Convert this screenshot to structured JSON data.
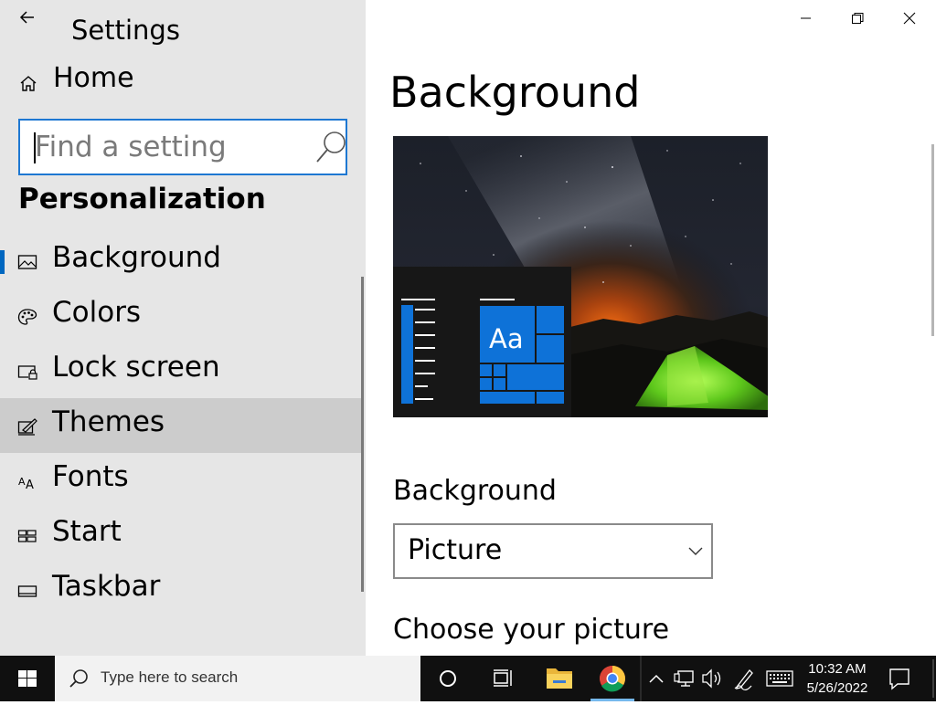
{
  "window": {
    "app_title": "Settings",
    "controls": {
      "minimize": "minimize",
      "restore": "restore",
      "close": "close"
    }
  },
  "sidebar": {
    "home_label": "Home",
    "search": {
      "placeholder": "Find a setting",
      "value": ""
    },
    "section_title": "Personalization",
    "items": [
      {
        "label": "Background",
        "icon": "picture-icon",
        "selected": true
      },
      {
        "label": "Colors",
        "icon": "palette-icon",
        "selected": false
      },
      {
        "label": "Lock screen",
        "icon": "lock-screen-icon",
        "selected": false
      },
      {
        "label": "Themes",
        "icon": "brush-icon",
        "selected": false,
        "hover": true
      },
      {
        "label": "Fonts",
        "icon": "font-icon",
        "selected": false
      },
      {
        "label": "Start",
        "icon": "start-tiles-icon",
        "selected": false
      },
      {
        "label": "Taskbar",
        "icon": "taskbar-icon",
        "selected": false
      }
    ]
  },
  "main": {
    "title": "Background",
    "preview": {
      "sample_text": "Aa"
    },
    "background_field": {
      "label": "Background",
      "value": "Picture"
    },
    "choose_heading": "Choose your picture"
  },
  "taskbar": {
    "search_placeholder": "Type here to search",
    "time": "10:32 AM",
    "date": "5/26/2022"
  },
  "colors": {
    "accent": "#0067c0",
    "sidebar_bg": "#e6e6e6",
    "hover_bg": "#cccccc",
    "search_border": "#1e78d2",
    "tile_blue": "#0e72d8",
    "taskbar_bg": "#101010"
  }
}
